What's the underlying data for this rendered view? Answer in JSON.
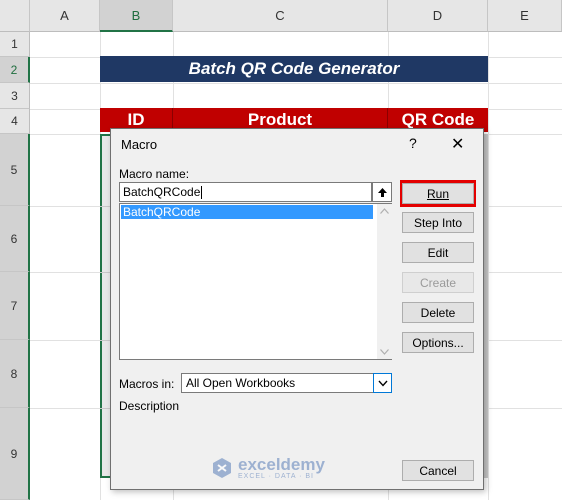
{
  "sheet": {
    "columns": [
      "A",
      "B",
      "C",
      "D",
      "E"
    ],
    "selected_column": "B",
    "rows": [
      "1",
      "2",
      "3",
      "4",
      "5",
      "6",
      "7",
      "8",
      "9"
    ],
    "selected_row": "2"
  },
  "content": {
    "banner_title": "Batch QR Code Generator",
    "table_headers": [
      "ID",
      "Product",
      "QR Code"
    ]
  },
  "dialog": {
    "title": "Macro",
    "help_icon": "?",
    "close_icon": "✕",
    "macro_name_label": "Macro name:",
    "macro_name_value": "BatchQRCode",
    "macro_list": [
      "BatchQRCode"
    ],
    "buttons": {
      "run": "Run",
      "step_into": "Step Into",
      "edit": "Edit",
      "create": "Create",
      "delete": "Delete",
      "options": "Options...",
      "cancel": "Cancel"
    },
    "macros_in_label": "Macros in:",
    "macros_in_value": "All Open Workbooks",
    "description_label": "Description"
  },
  "watermark": {
    "brand": "exceldemy",
    "tagline": "EXCEL · DATA · BI"
  },
  "colors": {
    "banner": "#1f3864",
    "table_header": "#c00000",
    "run_highlight": "#e30000",
    "selection": "#3399ff"
  }
}
